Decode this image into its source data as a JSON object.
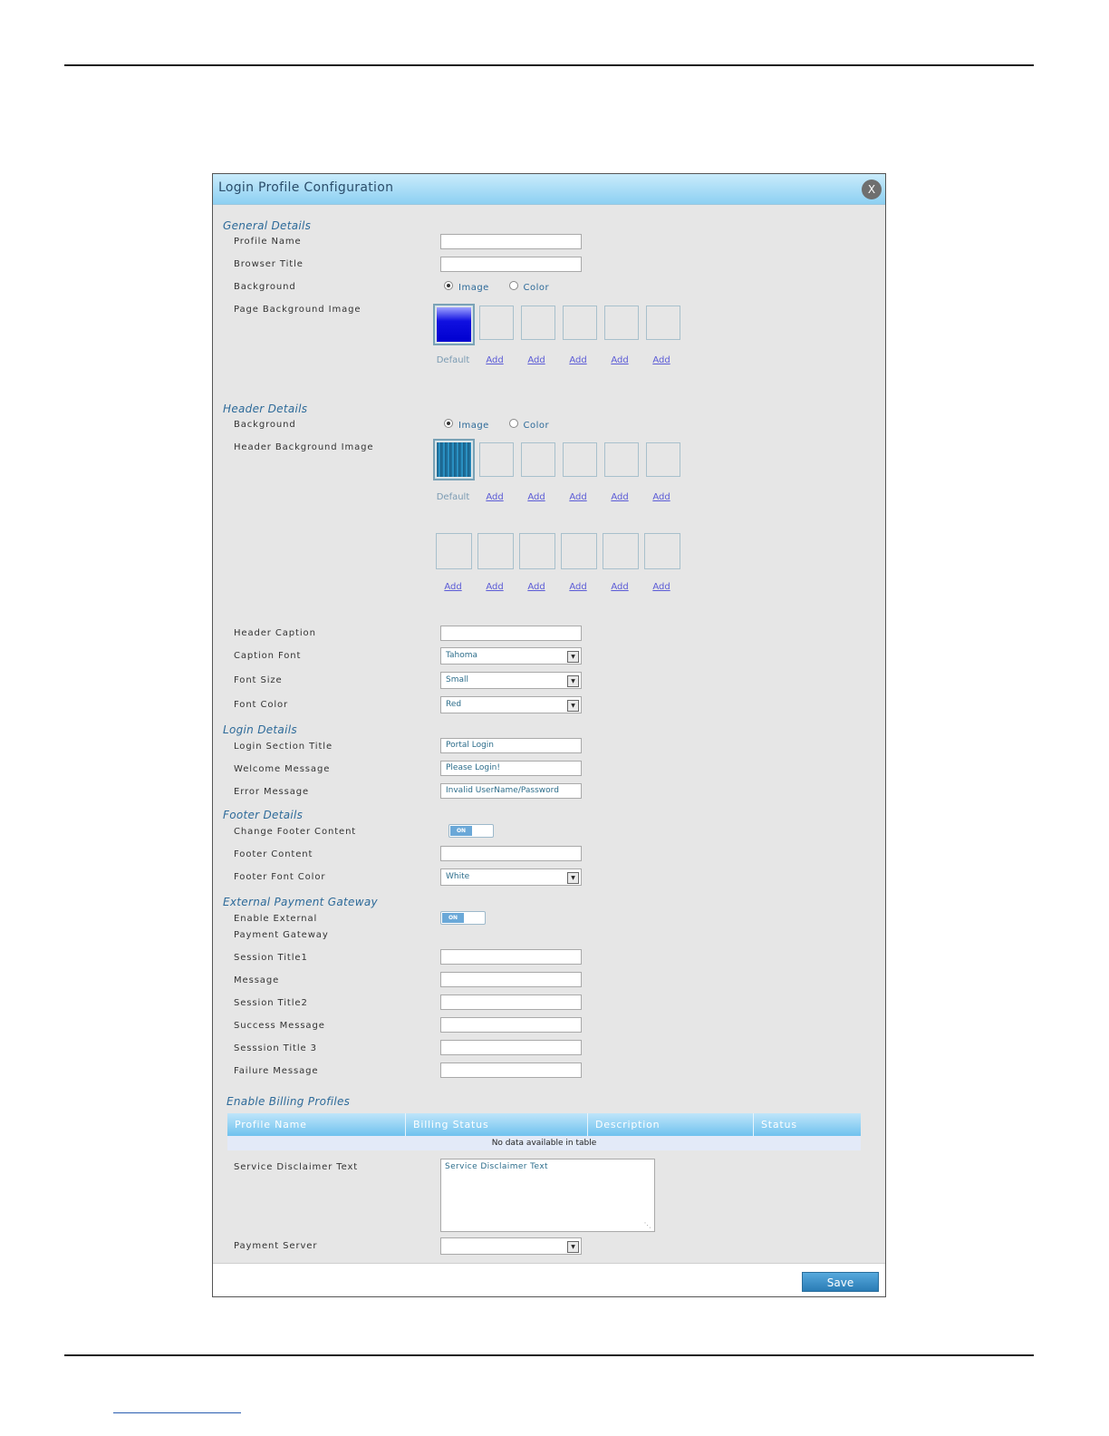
{
  "dialog": {
    "title": "Login Profile Configuration",
    "close_label": "X"
  },
  "general": {
    "heading": "General Details",
    "profile_name_label": "Profile Name",
    "browser_title_label": "Browser Title",
    "background_label": "Background",
    "radio_image": "Image",
    "radio_color": "Color",
    "page_bg_label": "Page Background Image",
    "default_caption": "Default",
    "add_label": "Add"
  },
  "header": {
    "heading": "Header Details",
    "background_label": "Background",
    "radio_image": "Image",
    "radio_color": "Color",
    "header_bg_label": "Header Background Image",
    "default_caption": "Default",
    "add_label": "Add",
    "caption_label": "Header Caption",
    "caption_font_label": "Caption Font",
    "caption_font_value": "Tahoma",
    "font_size_label": "Font Size",
    "font_size_value": "Small",
    "font_color_label": "Font Color",
    "font_color_value": "Red"
  },
  "login": {
    "heading": "Login Details",
    "section_title_label": "Login Section Title",
    "section_title_value": "Portal Login",
    "welcome_label": "Welcome Message",
    "welcome_value": "Please Login!",
    "error_label": "Error Message",
    "error_value": "Invalid UserName/Password"
  },
  "footer": {
    "heading": "Footer Details",
    "change_label": "Change Footer Content",
    "toggle_on": "ON",
    "content_label": "Footer Content",
    "font_color_label": "Footer Font Color",
    "font_color_value": "White"
  },
  "payment": {
    "heading": "External Payment Gateway",
    "enable_label_1": "Enable External",
    "enable_label_2": "Payment Gateway",
    "toggle_on": "ON",
    "session_title1_label": "Session Title1",
    "message_label": "Message",
    "session_title2_label": "Session Title2",
    "success_label": "Success Message",
    "session_title3_label": "Sesssion Title 3",
    "failure_label": "Failure Message"
  },
  "billing": {
    "heading": "Enable Billing Profiles",
    "columns": [
      "Profile Name",
      "Billing Status",
      "Description",
      "Status"
    ],
    "empty_text": "No data available in table",
    "disclaimer_label": "Service Disclaimer Text",
    "disclaimer_value": "Service Disclaimer Text",
    "payment_server_label": "Payment Server",
    "payment_server_value": ""
  },
  "actions": {
    "save_label": "Save"
  }
}
